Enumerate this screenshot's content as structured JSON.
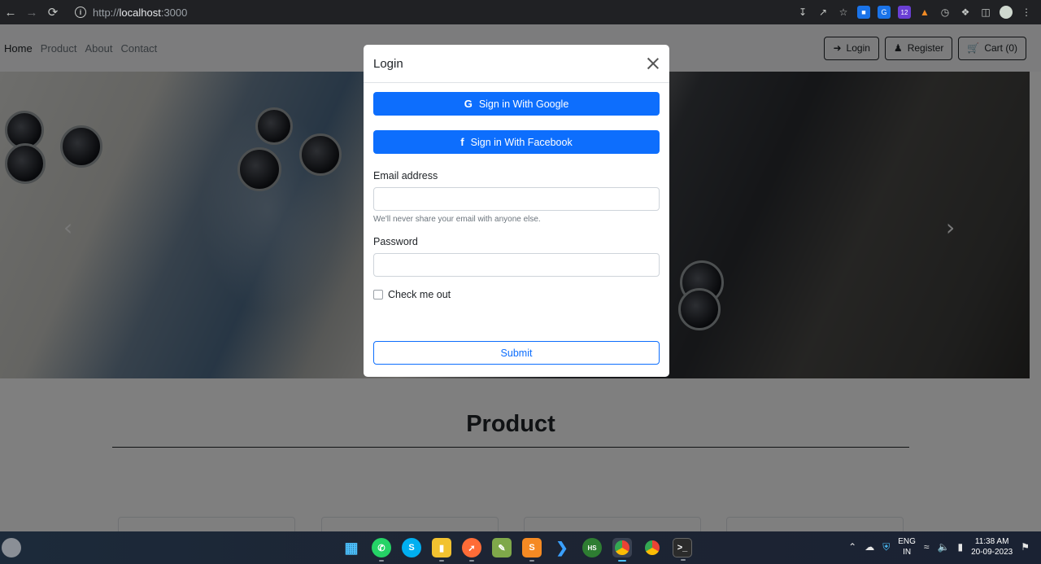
{
  "browser": {
    "url_scheme": "http://",
    "url_host": "localhost",
    "url_port": ":3000",
    "extension_badge": "12"
  },
  "navbar": {
    "links": [
      "Home",
      "Product",
      "About",
      "Contact"
    ],
    "buttons": {
      "login": "Login",
      "register": "Register",
      "cart": "Cart (0)"
    }
  },
  "carousel": {
    "prev_glyph": "‹",
    "next_glyph": "›"
  },
  "section": {
    "title": "Product"
  },
  "modal": {
    "title": "Login",
    "google_button": "Sign in With Google",
    "facebook_button": "Sign in With Facebook",
    "email_label": "Email address",
    "email_help": "We'll never share your email with anyone else.",
    "email_value": "",
    "password_label": "Password",
    "password_value": "",
    "checkbox_label": "Check me out",
    "checkbox_checked": false,
    "submit_button": "Submit"
  },
  "taskbar": {
    "apps": [
      "start",
      "whatsapp",
      "skype",
      "file-explorer",
      "postman",
      "notepad",
      "sublime-text",
      "vscode",
      "hs",
      "chrome",
      "chrome",
      "terminal"
    ],
    "lang_top": "ENG",
    "lang_bottom": "IN",
    "time": "11:38 AM",
    "date": "20-09-2023"
  },
  "colors": {
    "primary": "#0d6efd",
    "dark": "#212529",
    "backdrop": "rgba(0,0,0,0.5)"
  }
}
